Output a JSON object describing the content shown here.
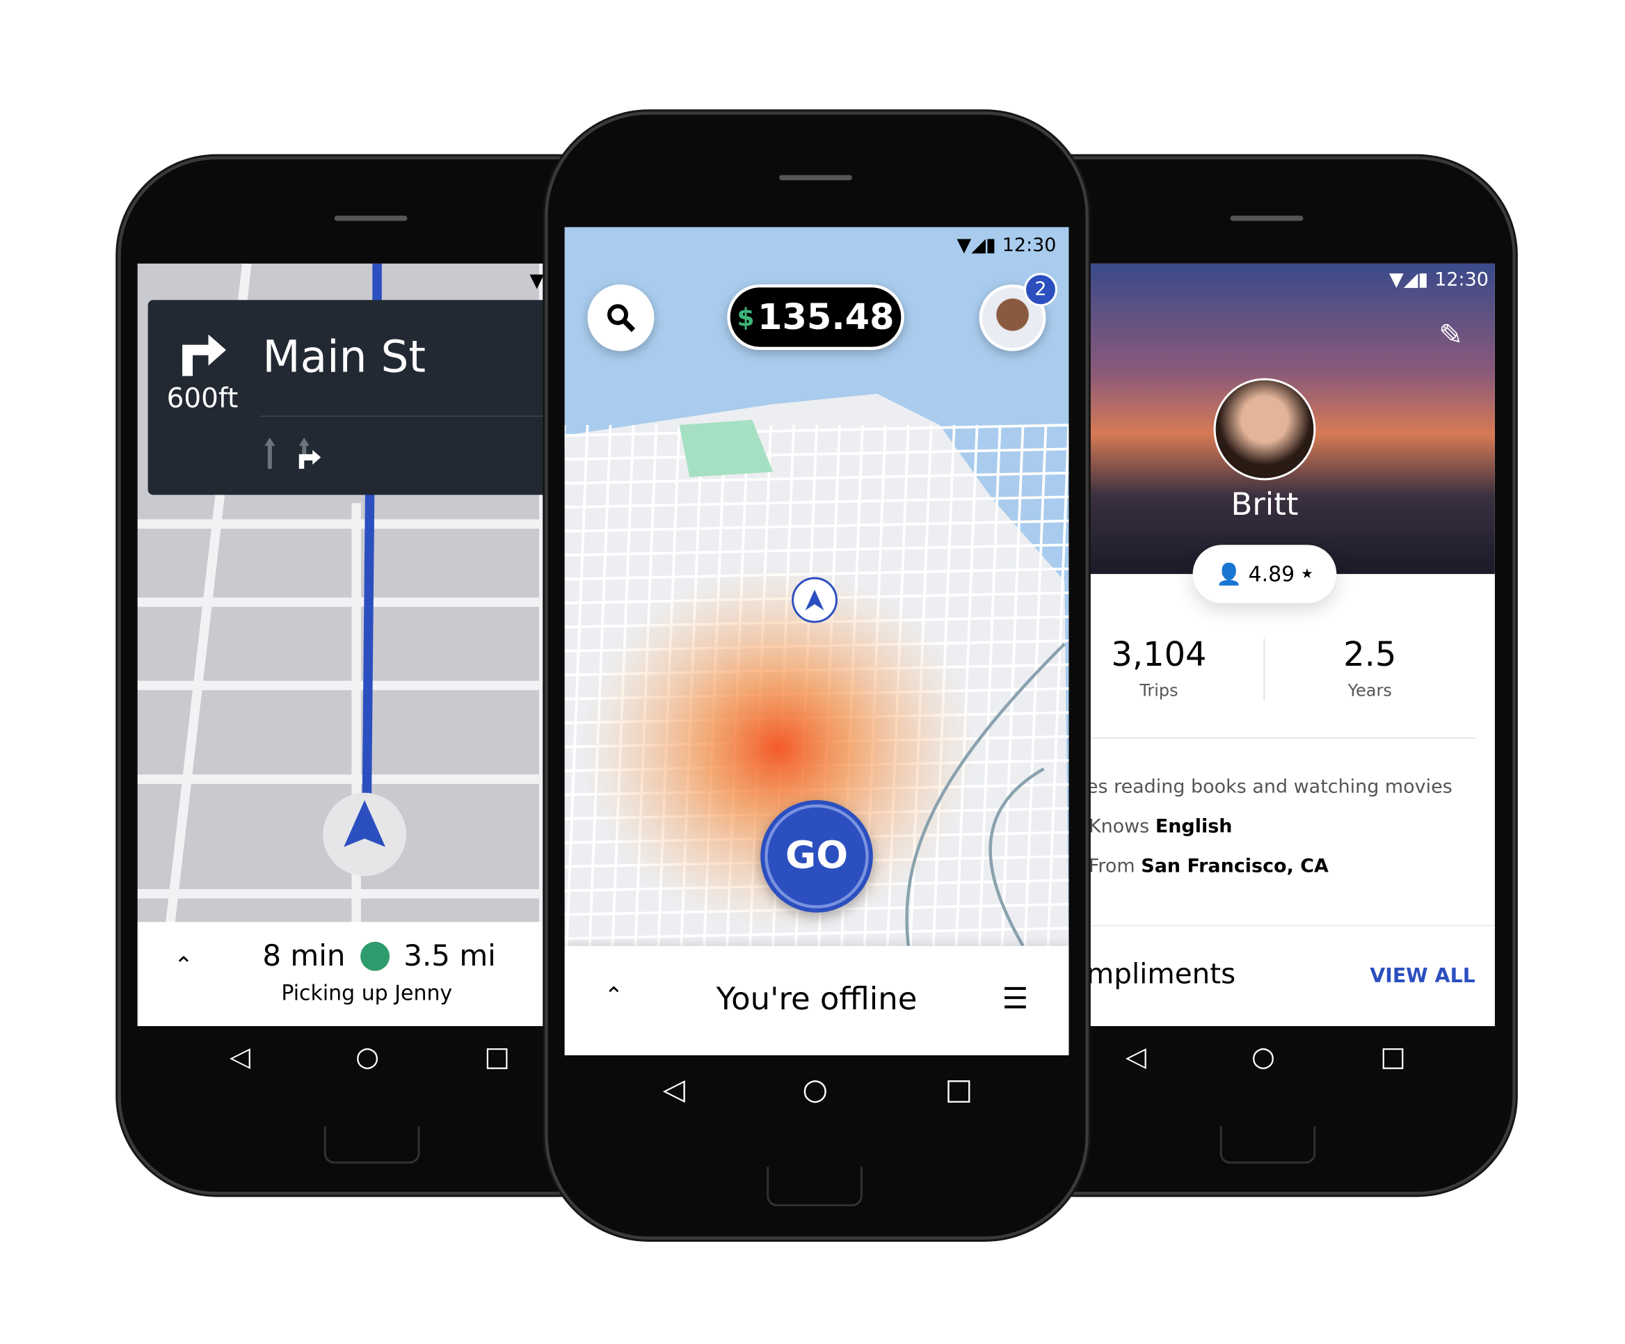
{
  "left_phone": {
    "turn_icon": "turn-right-arrow",
    "street": "Main St",
    "distance": "600ft",
    "lane_icons": [
      "straight-arrow",
      "straight-right-arrow"
    ],
    "eta": "8 min",
    "trip_distance": "3.5 mi",
    "status": "Picking up Jenny",
    "route_color": "#2c4fc0",
    "banner_color": "#222933"
  },
  "center_phone": {
    "time": "12:30",
    "earnings_currency": "$",
    "earnings": "135.48",
    "notification_count": "2",
    "go_label": "GO",
    "offline_label": "You're offline",
    "go_color": "#2c4fc0",
    "heat_color": "#f2521f"
  },
  "right_phone": {
    "time": "12:30",
    "name": "Britt",
    "rating": "4.89",
    "rating_star": "★",
    "trips_value": "3,104",
    "trips_label": "Trips",
    "years_value": "2.5",
    "years_label": "Years",
    "bio": "es reading books and watching movies",
    "knows_prefix": "Knows",
    "knows_value": "English",
    "from_prefix": "From",
    "from_value": "San Francisco, CA",
    "compliments_label": "mpliments",
    "view_all": "VIEW ALL",
    "accent": "#2c4fc0"
  }
}
